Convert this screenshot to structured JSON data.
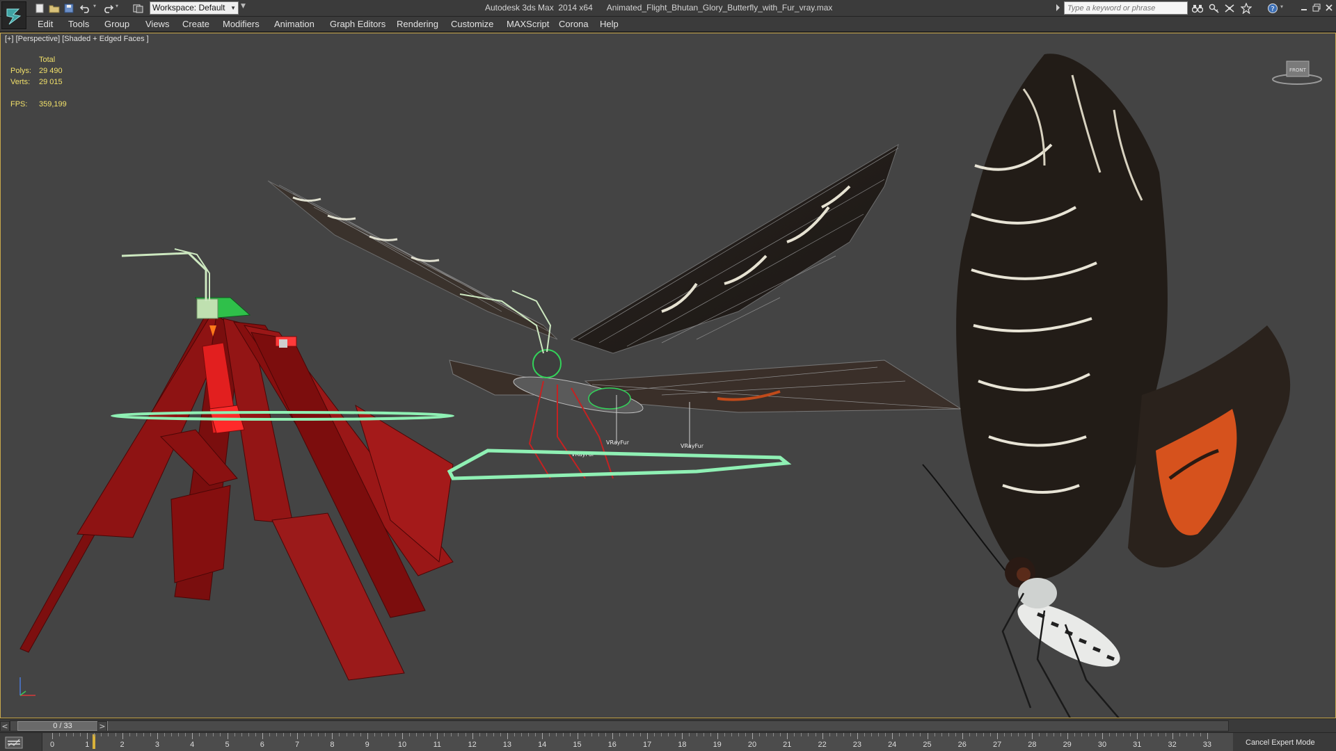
{
  "titlebar": {
    "app_title": "Autodesk 3ds Max  2014 x64",
    "file_name": "Animated_Flight_Bhutan_Glory_Butterfly_with_Fur_vray.max",
    "workspace_label": "Workspace: Default",
    "search_placeholder": "Type a keyword or phrase",
    "quick_access_icons": [
      "new-file-icon",
      "open-folder-icon",
      "save-icon",
      "undo-icon",
      "redo-icon",
      "project-folder-icon"
    ],
    "tool_icons": [
      "binoculars-icon",
      "key-icon",
      "exchange-icon",
      "star-icon",
      "help-icon"
    ],
    "window_buttons": [
      "minimize-icon",
      "restore-icon",
      "close-icon"
    ]
  },
  "menu": {
    "items": [
      "Edit",
      "Tools",
      "Group",
      "Views",
      "Create",
      "Modifiers",
      "Animation",
      "Graph Editors",
      "Rendering",
      "Customize",
      "MAXScript",
      "Corona",
      "Help"
    ]
  },
  "viewport": {
    "label": "[+] [Perspective] [Shaded + Edged Faces ]",
    "stats": {
      "header": "Total",
      "polys_label": "Polys:",
      "polys_value": "29 490",
      "verts_label": "Verts:",
      "verts_value": "29 015",
      "fps_label": "FPS:",
      "fps_value": "359,199"
    },
    "vrayfur_labels": [
      "VRayFur",
      "VRayFur",
      "VRayFur"
    ],
    "viewcube_label": "FRONT",
    "colors": {
      "background": "#444444",
      "selection_border": "#c9a84b",
      "stats_text": "#f1e06a",
      "bone_red": "#8b1414",
      "helper_green": "#8ff0b4"
    }
  },
  "timeline": {
    "frame_readout": "0 / 33",
    "prev_label": "<",
    "next_label": ">",
    "ticks": [
      "0",
      "1",
      "2",
      "3",
      "4",
      "5",
      "6",
      "7",
      "8",
      "9",
      "10",
      "11",
      "12",
      "13",
      "14",
      "15",
      "16",
      "17",
      "18",
      "19",
      "20",
      "21",
      "22",
      "23",
      "24",
      "25",
      "26",
      "27",
      "28",
      "29",
      "30",
      "31",
      "32",
      "33"
    ],
    "cancel_expert_label": "Cancel Expert Mode",
    "current_frame": 0,
    "total_frames": 33
  }
}
